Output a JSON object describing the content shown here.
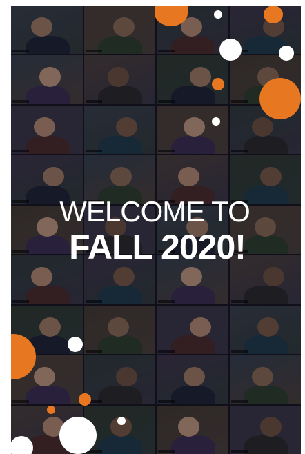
{
  "headline": {
    "line1": "WELCOME TO",
    "line2": "FALL 2020!"
  },
  "colors": {
    "accent_orange": "#e87722",
    "dot_white": "#ffffff",
    "background": "#16131d"
  }
}
